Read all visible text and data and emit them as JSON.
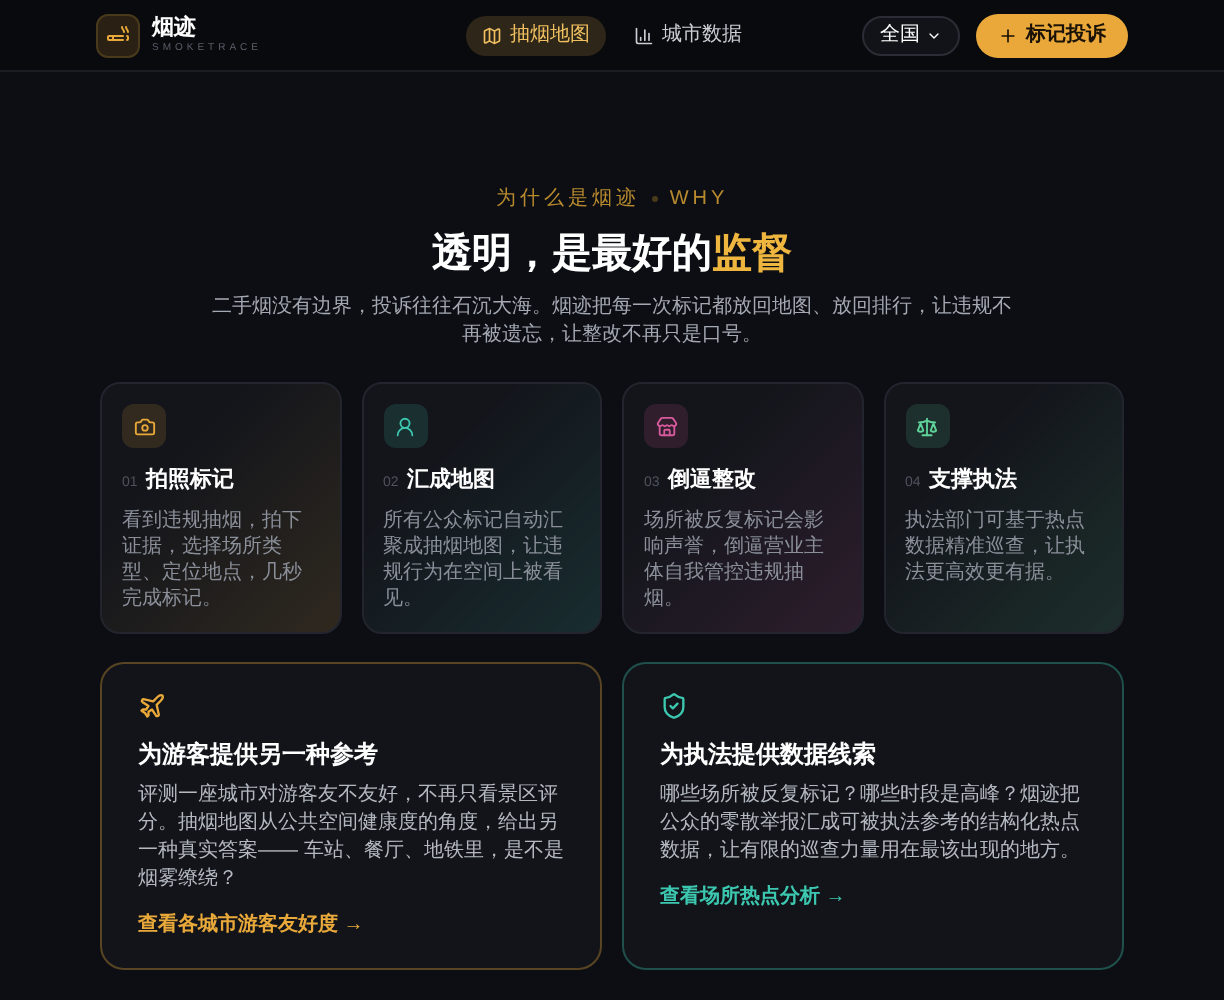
{
  "header": {
    "brand": "烟迹",
    "brand_sub": "SMOKETRACE",
    "tabs": [
      {
        "label": "抽烟地图",
        "selected": true
      },
      {
        "label": "城市数据",
        "selected": false
      }
    ],
    "region": "全国",
    "action": "标记投诉"
  },
  "hero": {
    "eyebrow": "为什么是烟迹",
    "eyebrow_en": "WHY",
    "title_main": "透明，是最好的",
    "title_highlight": "监督",
    "subtitle": "二手烟没有边界，投诉往往石沉大海。烟迹把每一次标记都放回地图、放回排行，让违规不再被遗忘，让整改不再只是口号。"
  },
  "features": [
    {
      "kind": "camera",
      "color": "#e8a93a",
      "number": "01",
      "title": "拍照标记",
      "text": "看到违规抽烟，拍下证据，选择场所类型、定位地点，几秒完成标记。"
    },
    {
      "kind": "person",
      "color": "#3cc8b0",
      "number": "02",
      "title": "汇成地图",
      "text": "所有公众标记自动汇聚成抽烟地图，让违规行为在空间上被看见。"
    },
    {
      "kind": "store",
      "color": "#d65a9c",
      "number": "03",
      "title": "倒逼整改",
      "text": "场所被反复标记会影响声誉，倒逼营业主体自我管控违规抽烟。"
    },
    {
      "kind": "scale",
      "color": "#5fd39a",
      "number": "04",
      "title": "支撑执法",
      "text": "执法部门可基于热点数据精准巡查，让执法更高效更有据。"
    }
  ],
  "audiences": [
    {
      "kind": "plane",
      "color": "#e8a93a",
      "title": "为游客提供另一种参考",
      "text": "评测一座城市对游客友不友好，不再只看景区评分。抽烟地图从公共空间健康度的角度，给出另一种真实答案—— 车站、餐厅、地铁里，是不是烟雾缭绕？",
      "link": "查看各城市游客友好度 →"
    },
    {
      "kind": "shield",
      "color": "#3cc8b0",
      "title": "为执法提供数据线索",
      "text": "哪些场所被反复标记？哪些时段是高峰？烟迹把公众的零散举报汇成可被执法参考的结构化热点数据，让有限的巡查力量用在最该出现的地方。",
      "link": "查看场所热点分析 →"
    }
  ]
}
